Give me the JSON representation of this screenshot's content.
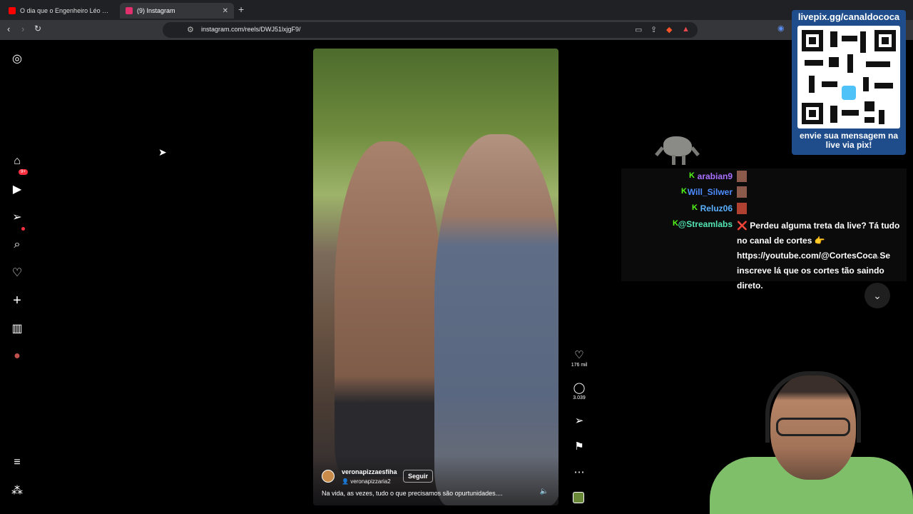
{
  "browser": {
    "tabs": [
      {
        "title": "O dia que o Engenheiro Léo do MBL",
        "favicon_color": "#ff0000"
      },
      {
        "title": "(9) Instagram",
        "favicon_color": "#e1306c"
      }
    ],
    "new_tab": "+",
    "url": "instagram.com/reels/DWJ51lxjgF9/"
  },
  "sidebar": {
    "items": [
      {
        "name": "instagram-logo-icon",
        "glyph": "◎"
      },
      {
        "name": "home-icon",
        "glyph": "⌂"
      },
      {
        "name": "reels-icon",
        "glyph": "▶"
      },
      {
        "name": "messages-icon",
        "glyph": "➢"
      },
      {
        "name": "search-icon",
        "glyph": "⌕"
      },
      {
        "name": "notifications-icon",
        "glyph": "♡"
      },
      {
        "name": "create-icon",
        "glyph": "+"
      },
      {
        "name": "dashboard-icon",
        "glyph": "▥"
      },
      {
        "name": "profile-avatar",
        "glyph": "●"
      },
      {
        "name": "more-menu-icon",
        "glyph": "≡"
      },
      {
        "name": "also-from-meta-icon",
        "glyph": "⁂"
      }
    ],
    "messages_badge": "9+"
  },
  "reel": {
    "author": "veronapizzaesfiha",
    "audio_author": "veronapizzaria2",
    "follow_label": "Seguir",
    "caption": "Na vida, as vezes, tudo o que precisamos são opurtunidades....",
    "likes": "176 mil",
    "comments": "3.039"
  },
  "overlay": {
    "qr_title": "livepix.gg/canaldococa",
    "qr_footer_line1": "envie sua mensagem na",
    "qr_footer_line2": "live via pix!",
    "qr_color": "#1f4d8c",
    "chat": [
      {
        "user": "arabian9",
        "color": "#a970ff"
      },
      {
        "user": "Will_Silwer",
        "color": "#4d8cff"
      },
      {
        "user": "Reluz06",
        "color": "#5ab0ff"
      },
      {
        "user": "@Streamlabs",
        "color": "#53e6b4"
      }
    ],
    "chat_message": "❌ Perdeu alguma treta da live? Tá tudo no canal de cortes 👉 https://youtube.com/@CortesCoca Se inscreve lá que os cortes tão saindo direto.",
    "kick_badge": "K",
    "kick_color": "#53fc18"
  }
}
